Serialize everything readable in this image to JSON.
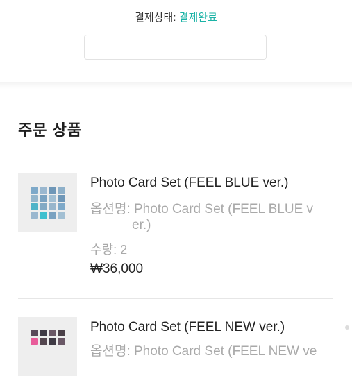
{
  "payment": {
    "status_label": "결제상태: ",
    "status_value": "결제완료",
    "status_color": "#1bb3a6"
  },
  "order": {
    "section_title": "주문 상품",
    "items": [
      {
        "name": "Photo Card Set (FEEL BLUE ver.)",
        "option_line1": "옵션명: Photo Card Set (FEEL BLUE v",
        "option_line2": "er.)",
        "quantity": "수량: 2",
        "price": "₩36,000",
        "thumbnail_icon": "photo-card-set-thumbnail"
      },
      {
        "name": "Photo Card Set (FEEL NEW ver.)",
        "option_line1": "옵션명: Photo Card Set (FEEL NEW ve",
        "thumbnail_icon": "photo-card-set-thumbnail"
      }
    ]
  }
}
